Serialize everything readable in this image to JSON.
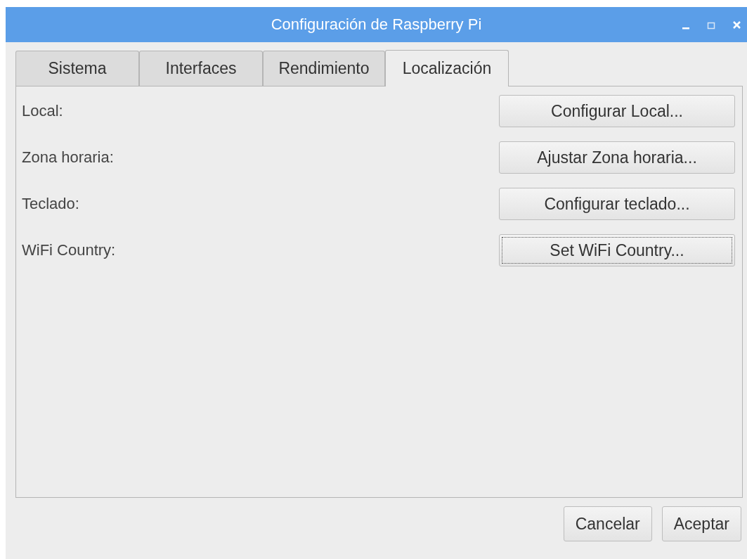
{
  "window": {
    "title": "Configuración de Raspberry Pi",
    "controls": [
      {
        "kind": "minimize"
      },
      {
        "kind": "maximize"
      },
      {
        "kind": "close"
      }
    ]
  },
  "tabs": [
    {
      "label": "Sistema",
      "selected": false
    },
    {
      "label": "Interfaces",
      "selected": false
    },
    {
      "label": "Rendimiento",
      "selected": false
    },
    {
      "label": "Localización",
      "selected": true
    }
  ],
  "rows": [
    {
      "label": "Local:",
      "button": "Configurar Local...",
      "focused": false
    },
    {
      "label": "Zona horaria:",
      "button": "Ajustar Zona horaria...",
      "focused": false
    },
    {
      "label": "Teclado:",
      "button": "Configurar teclado...",
      "focused": false
    },
    {
      "label": "WiFi Country:",
      "button": "Set WiFi Country...",
      "focused": true
    }
  ],
  "buttons": [
    "Cancelar",
    "Aceptar"
  ]
}
